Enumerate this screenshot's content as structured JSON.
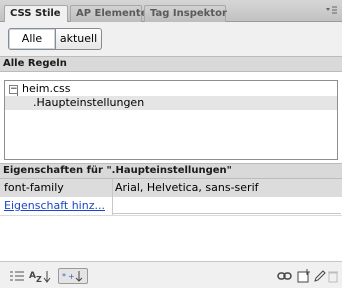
{
  "tabs": [
    {
      "label": "CSS Stile",
      "active": true
    },
    {
      "label": "AP Elemente",
      "active": false
    },
    {
      "label": "Tag Inspektor",
      "active": false
    }
  ],
  "mode": {
    "all_label": "Alle",
    "current_label": "aktuell",
    "selected": "Alle"
  },
  "rules": {
    "header": "Alle Regeln",
    "stylesheet": "heim.css",
    "selected_rule": ".Haupteinstellungen"
  },
  "properties": {
    "header": "Eigenschaften für \".Haupteinstellungen\"",
    "rows": [
      {
        "name": "font-family",
        "value": "Arial, Helvetica, sans-serif"
      }
    ],
    "add_link": "Eigenschaft hinz..."
  },
  "icons": {
    "tab_menu": "panel-menu-icon",
    "tree_toggle": "collapse-minus-icon",
    "show_category": "category-view-icon",
    "show_az": "alphabetical-view-icon",
    "show_set": "set-properties-view-icon",
    "attach": "attach-stylesheet-icon",
    "new_rule": "new-css-rule-icon",
    "edit": "edit-pencil-icon",
    "delete": "trash-icon"
  },
  "colors": {
    "link": "#1b46c9",
    "selected_row": "#e5e5e5",
    "section_header": "#d9d9d9"
  }
}
